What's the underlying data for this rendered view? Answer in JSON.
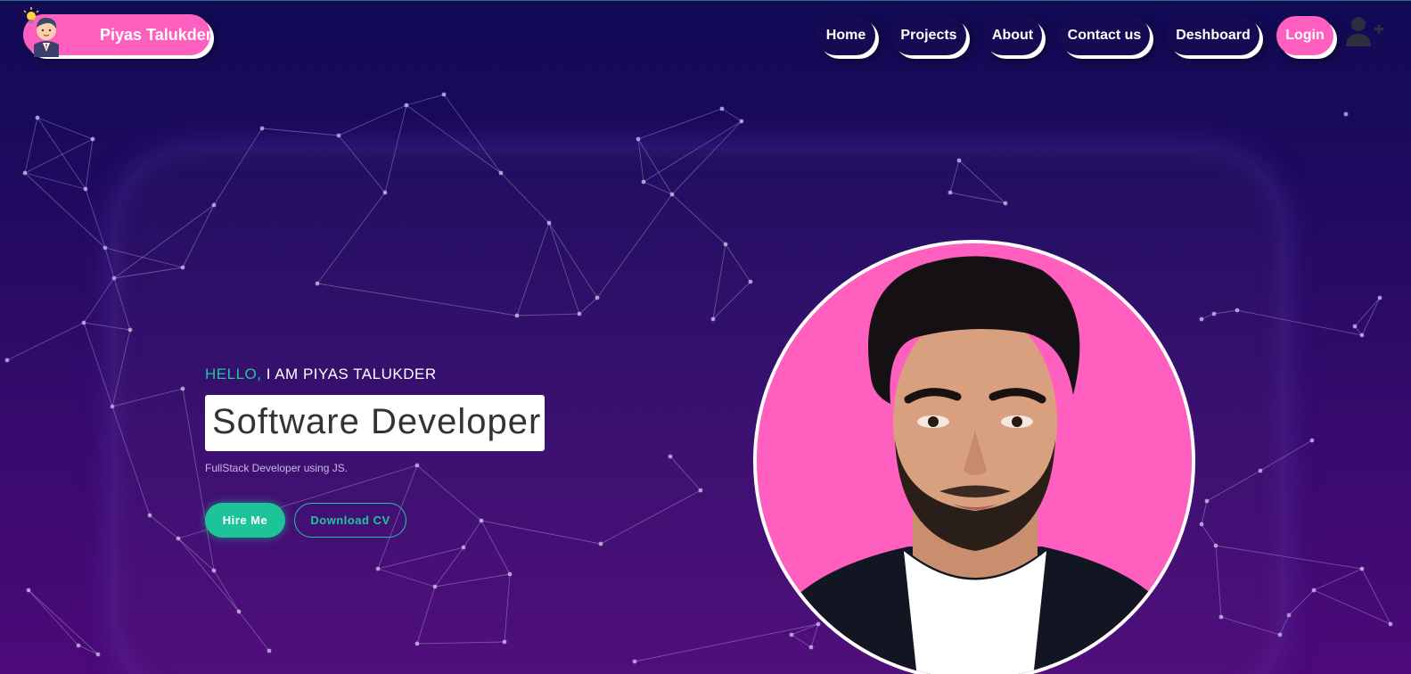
{
  "header": {
    "brand_name": "Piyas Talukder",
    "nav": [
      "Home",
      "Projects",
      "About",
      "Contact us",
      "Deshboard",
      "Login"
    ],
    "user_icon": "user-plus-icon"
  },
  "hero": {
    "greeting": "HELLO,",
    "intro": " I AM PIYAS TALUKDER",
    "role": "Software Developer",
    "tagline": "FullStack Developer using JS.",
    "hire_label": "Hire Me",
    "cv_label": "Download CV"
  },
  "colors": {
    "accent_pink": "#ff5fbf",
    "accent_teal": "#1fc7a0",
    "nav_bg": "#160b52",
    "bg_top": "#110a55",
    "bg_bottom": "#4c0a78"
  }
}
